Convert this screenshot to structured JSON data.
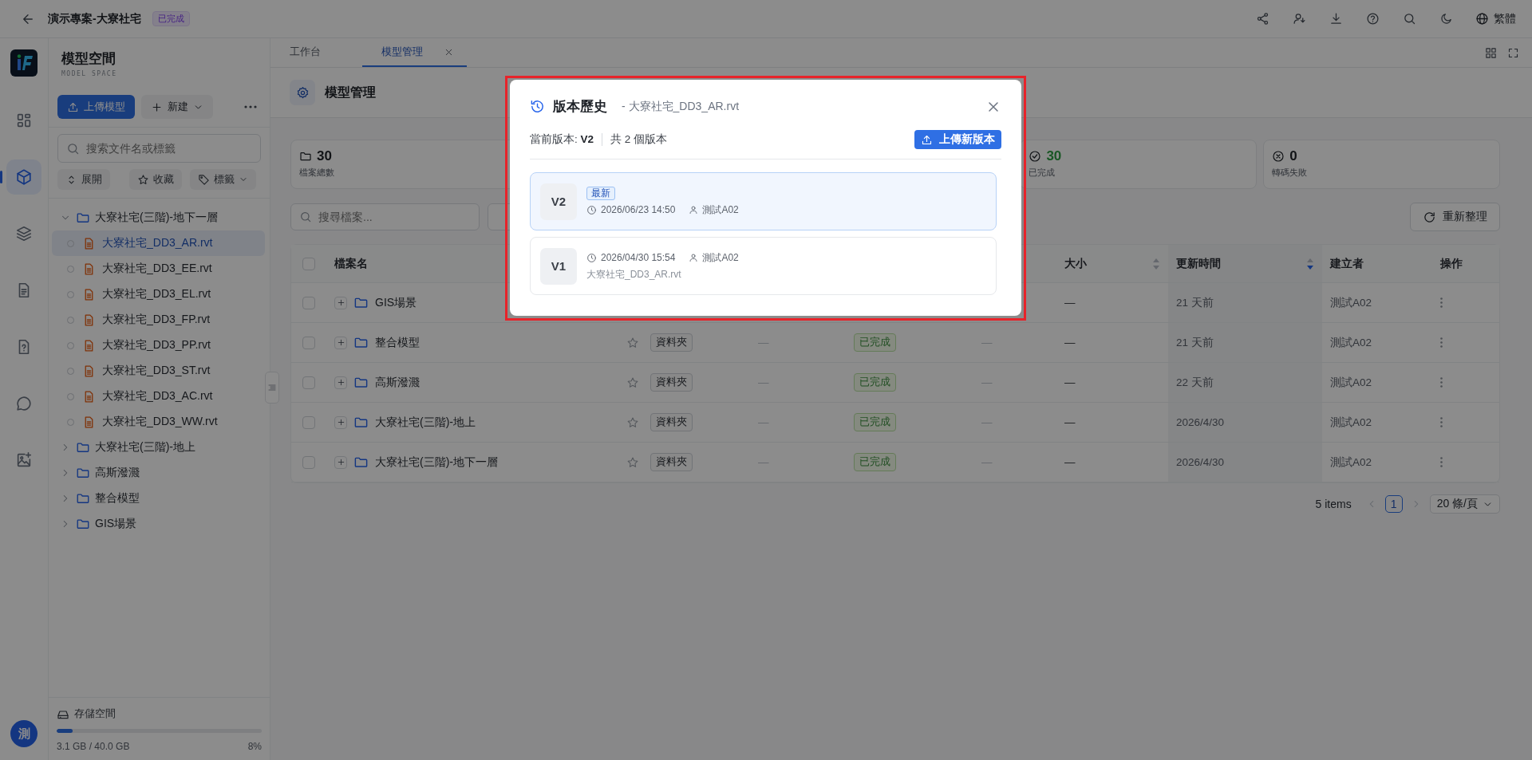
{
  "topbar": {
    "title": "演示專案-大寮社宅",
    "badge": "已完成",
    "actions": [
      {
        "kind": "share"
      },
      {
        "kind": "people"
      },
      {
        "kind": "download"
      },
      {
        "kind": "help"
      },
      {
        "kind": "search"
      },
      {
        "kind": "moon"
      }
    ],
    "language": "繁體"
  },
  "rail": {
    "items": [
      {
        "kind": "grid",
        "selected": false
      },
      {
        "kind": "cube",
        "selected": true
      },
      {
        "kind": "layers",
        "selected": false
      },
      {
        "kind": "doc",
        "selected": false
      },
      {
        "kind": "doc-question",
        "selected": false
      },
      {
        "kind": "chat",
        "selected": false
      },
      {
        "kind": "image-plus",
        "selected": false
      }
    ],
    "avatar": "測"
  },
  "sidebar": {
    "title": "模型空間",
    "subtitle": "MODEL SPACE",
    "upload_button": "上傳模型",
    "new_button": "新建",
    "search": {
      "placeholder": "搜索文件名或標籤"
    },
    "filters": [
      {
        "kind": "expand",
        "label": "展開"
      },
      {
        "kind": "star",
        "label": "收藏"
      },
      {
        "kind": "tag",
        "label": "標籤"
      }
    ],
    "tree": [
      {
        "label": "大寮社宅(三階)-地下一層",
        "kind": "folder",
        "expanded": true,
        "selected": false,
        "children": [
          {
            "label": "大寮社宅_DD3_AR.rvt",
            "kind": "file",
            "selected": true
          },
          {
            "label": "大寮社宅_DD3_EE.rvt",
            "kind": "file",
            "selected": false
          },
          {
            "label": "大寮社宅_DD3_EL.rvt",
            "kind": "file",
            "selected": false
          },
          {
            "label": "大寮社宅_DD3_FP.rvt",
            "kind": "file",
            "selected": false
          },
          {
            "label": "大寮社宅_DD3_PP.rvt",
            "kind": "file",
            "selected": false
          },
          {
            "label": "大寮社宅_DD3_ST.rvt",
            "kind": "file",
            "selected": false
          },
          {
            "label": "大寮社宅_DD3_AC.rvt",
            "kind": "file",
            "selected": false
          },
          {
            "label": "大寮社宅_DD3_WW.rvt",
            "kind": "file",
            "selected": false
          }
        ]
      },
      {
        "label": "大寮社宅(三階)-地上",
        "kind": "folder",
        "expanded": false,
        "selected": false
      },
      {
        "label": "高斯潑濺",
        "kind": "folder",
        "expanded": false,
        "selected": false
      },
      {
        "label": "整合模型",
        "kind": "folder",
        "expanded": false,
        "selected": false
      },
      {
        "label": "GIS場景",
        "kind": "folder",
        "expanded": false,
        "selected": false
      }
    ],
    "storage": {
      "label": "存儲空間",
      "level": 0.078,
      "usage": "3.1 GB / 40.0 GB",
      "percent": "8%"
    }
  },
  "tabs": [
    {
      "label": "工作台",
      "selected": false,
      "closable": false
    },
    {
      "label": "模型管理",
      "selected": true,
      "closable": true
    }
  ],
  "page": {
    "title": "模型管理"
  },
  "stats": [
    {
      "kind": "total",
      "value": "30",
      "label": "檔案總數"
    },
    {
      "kind": "done",
      "value": "30",
      "label": "已完成"
    },
    {
      "kind": "failed",
      "value": "0",
      "label": "轉碼失敗"
    }
  ],
  "search": {
    "placeholder": "搜尋檔案..."
  },
  "refresh_button": "重新整理",
  "table": {
    "header_checked": false,
    "columns": [
      {
        "kind": "name",
        "label": "檔案名"
      },
      {
        "kind": "star"
      },
      {
        "kind": "tag"
      },
      {
        "kind": "text"
      },
      {
        "kind": "status"
      },
      {
        "kind": "text"
      },
      {
        "kind": "text",
        "label": "大小",
        "sortable": true,
        "sorted": false
      },
      {
        "kind": "text",
        "label": "更新時間",
        "sortable": true,
        "sorted": true
      },
      {
        "kind": "text",
        "label": "建立者"
      },
      {
        "kind": "menu",
        "label": "操作"
      }
    ],
    "rows": [
      {
        "checked": false,
        "name": "GIS場景",
        "size": "—",
        "updated": "21 天前",
        "creator": "測試A02"
      },
      {
        "checked": false,
        "name": "整合模型",
        "favorite": false,
        "type": "資料夾",
        "col_4": "—",
        "status": "已完成",
        "col_6": "—",
        "size": "—",
        "updated": "21 天前",
        "creator": "測試A02"
      },
      {
        "checked": false,
        "name": "高斯潑濺",
        "favorite": false,
        "type": "資料夾",
        "col_4": "—",
        "status": "已完成",
        "col_6": "—",
        "size": "—",
        "updated": "22 天前",
        "creator": "測試A02"
      },
      {
        "checked": false,
        "name": "大寮社宅(三階)-地上",
        "favorite": false,
        "type": "資料夾",
        "col_4": "—",
        "status": "已完成",
        "col_6": "—",
        "size": "—",
        "updated": "2026/4/30",
        "creator": "測試A02"
      },
      {
        "checked": false,
        "name": "大寮社宅(三階)-地下一層",
        "favorite": false,
        "type": "資料夾",
        "col_4": "—",
        "status": "已完成",
        "col_6": "—",
        "size": "—",
        "updated": "2026/4/30",
        "creator": "測試A02"
      }
    ]
  },
  "pagination": {
    "total": "5 items",
    "pages": [
      {
        "label": "1",
        "selected": true
      }
    ],
    "page_size": "20 條/頁"
  },
  "modal": {
    "title": "版本歷史",
    "subtitle": "- 大寮社宅_DD3_AR.rvt",
    "current_label": "當前版本:",
    "current_version": "V2",
    "count": "共 2 個版本",
    "upload_button": "上傳新版本",
    "versions": [
      {
        "version": "V2",
        "badge": "最新",
        "date": "2026/06/23 14:50",
        "user": "測試A02",
        "selected": true
      },
      {
        "version": "V1",
        "date": "2026/04/30 15:54",
        "user": "測試A02",
        "file": "大寮社宅_DD3_AR.rvt",
        "selected": false
      }
    ]
  }
}
